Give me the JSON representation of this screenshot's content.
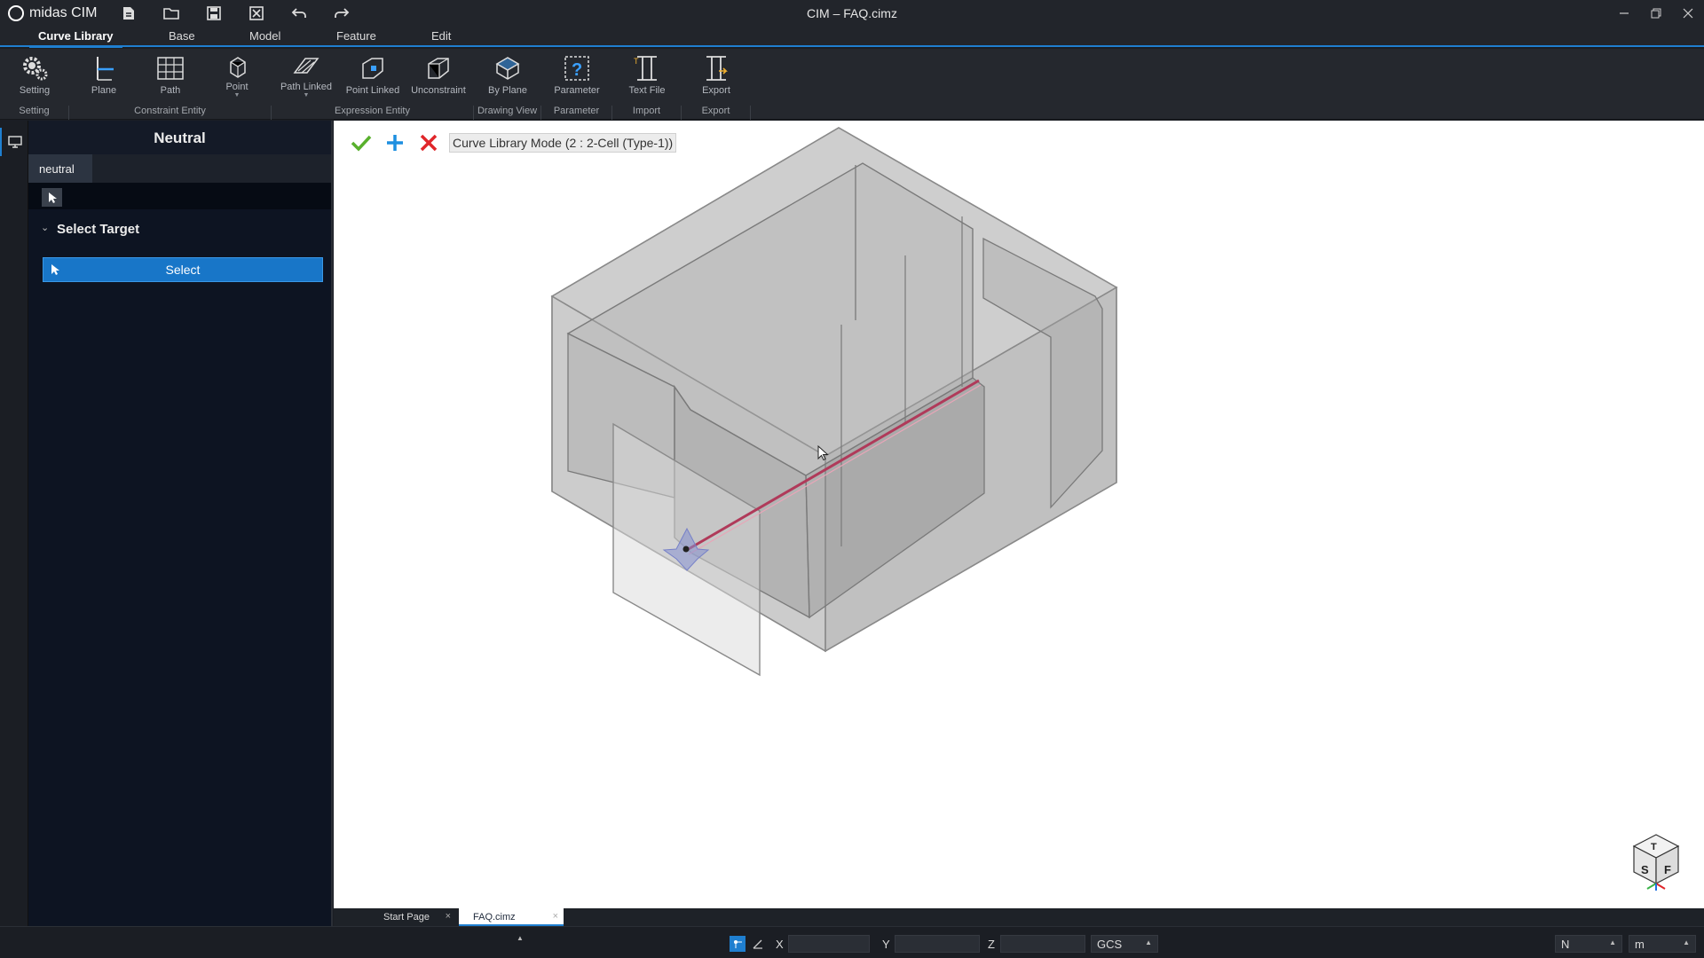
{
  "app": {
    "name": "midas CIM",
    "title": "CIM – FAQ.cimz"
  },
  "menu_tabs": [
    "Curve Library",
    "Base",
    "Model",
    "Feature",
    "Edit"
  ],
  "ribbon": {
    "buttons": {
      "setting": "Setting",
      "plane": "Plane",
      "path": "Path",
      "point": "Point",
      "path_linked": "Path Linked",
      "point_linked": "Point Linked",
      "unconstraint": "Unconstraint",
      "by_plane": "By Plane",
      "parameter": "Parameter",
      "text_file": "Text File",
      "export": "Export"
    },
    "groups": {
      "setting": "Setting",
      "constraint_entity": "Constraint Entity",
      "expression_entity": "Expression Entity",
      "drawing_view": "Drawing View",
      "parameter": "Parameter",
      "import": "Import",
      "export": "Export"
    }
  },
  "panel": {
    "title": "Neutral",
    "tab": "neutral",
    "section_title": "Select Target",
    "select_label": "Select"
  },
  "viewport": {
    "mode_label": "Curve Library Mode (2 : 2-Cell (Type-1))"
  },
  "doc_tabs": [
    "Start Page",
    "FAQ.cimz"
  ],
  "status": {
    "x_label": "X",
    "y_label": "Y",
    "z_label": "Z",
    "coord_system": "GCS",
    "unit_force": "N",
    "unit_length": "m"
  },
  "colors": {
    "accent": "#1f7fd0",
    "path_line": "#b03a5a",
    "confirm": "#58b02c",
    "cancel": "#e0262a"
  }
}
